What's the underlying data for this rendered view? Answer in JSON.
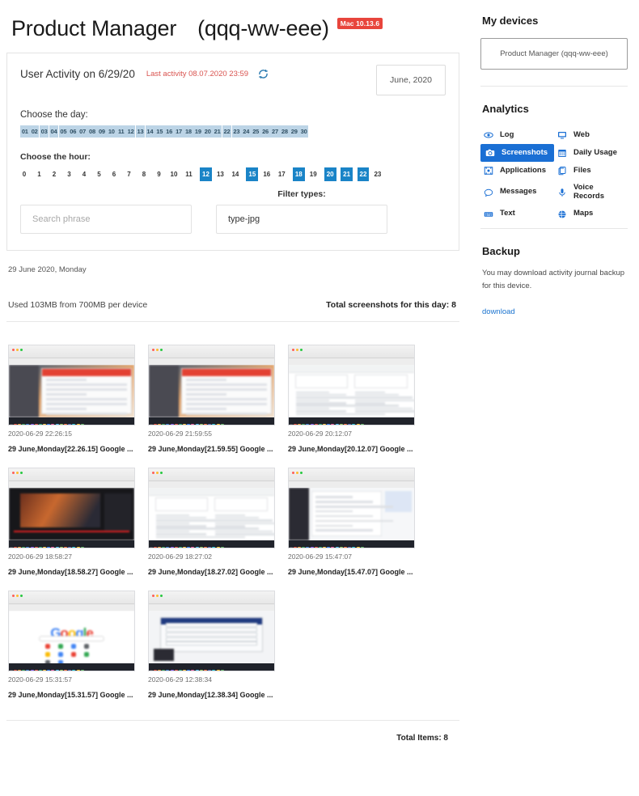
{
  "header": {
    "title": "Product Manager",
    "device": "(qqq-ww-eee)",
    "os_badge": "Mac 10.13.6"
  },
  "activity": {
    "title": "User Activity on 6/29/20",
    "last_activity": "Last activity 08.07.2020 23:59",
    "refresh_icon": "refresh-icon",
    "month_button": "June, 2020",
    "day_label": "Choose the day:",
    "days": [
      "01",
      "02",
      "03",
      "04",
      "05",
      "06",
      "07",
      "08",
      "09",
      "10",
      "11",
      "12",
      "13",
      "14",
      "15",
      "16",
      "17",
      "18",
      "19",
      "20",
      "21",
      "22",
      "23",
      "24",
      "25",
      "26",
      "27",
      "28",
      "29",
      "30"
    ],
    "hour_label": "Choose the hour:",
    "hours": [
      "0",
      "1",
      "2",
      "3",
      "4",
      "5",
      "6",
      "7",
      "8",
      "9",
      "10",
      "11",
      "12",
      "13",
      "14",
      "15",
      "16",
      "17",
      "18",
      "19",
      "20",
      "21",
      "22",
      "23"
    ],
    "hours_selected": [
      "12",
      "15",
      "18",
      "20",
      "21",
      "22"
    ],
    "search_placeholder": "Search phrase",
    "filter_caption": "Filter types:",
    "filter_value": "type-jpg"
  },
  "meta": {
    "date_line": "29 June 2020, Monday",
    "usage": "Used 103MB from 700MB per device",
    "total_day": "Total screenshots for this day: 8"
  },
  "thumbnails": [
    {
      "time": "2020-06-29 22:26:15",
      "title": "29 June,Monday[22.26.15] Google ...",
      "style": "shot-a"
    },
    {
      "time": "2020-06-29 21:59:55",
      "title": "29 June,Monday[21.59.55] Google ...",
      "style": "shot-a"
    },
    {
      "time": "2020-06-29 20:12:07",
      "title": "29 June,Monday[20.12.07] Google ...",
      "style": "shot-doc"
    },
    {
      "time": "2020-06-29 18:58:27",
      "title": "29 June,Monday[18.58.27] Google ...",
      "style": "shot-dark"
    },
    {
      "time": "2020-06-29 18:27:02",
      "title": "29 June,Monday[18.27.02] Google ...",
      "style": "shot-doc"
    },
    {
      "time": "2020-06-29 15:47:07",
      "title": "29 June,Monday[15.47.07] Google ...",
      "style": "shot-blue"
    },
    {
      "time": "2020-06-29 15:31:57",
      "title": "29 June,Monday[15.31.57] Google ...",
      "style": "shot-goog"
    },
    {
      "time": "2020-06-29 12:38:34",
      "title": "29 June,Monday[12.38.34] Google ...",
      "style": "shot-form"
    }
  ],
  "footer": {
    "total_items": "Total Items: 8"
  },
  "sidebar": {
    "devices_heading": "My devices",
    "device_item": "Product Manager (qqq-ww-eee)",
    "analytics_heading": "Analytics",
    "analytics": [
      {
        "label": "Log",
        "icon": "eye-icon",
        "active": false
      },
      {
        "label": "Web",
        "icon": "monitor-icon",
        "active": false
      },
      {
        "label": "Screenshots",
        "icon": "camera-icon",
        "active": true
      },
      {
        "label": "Daily Usage",
        "icon": "calendar-icon",
        "active": false
      },
      {
        "label": "Applications",
        "icon": "app-window-icon",
        "active": false
      },
      {
        "label": "Files",
        "icon": "files-icon",
        "active": false
      },
      {
        "label": "Messages",
        "icon": "chat-bubble-icon",
        "active": false
      },
      {
        "label": "Voice Records",
        "icon": "microphone-icon",
        "active": false
      },
      {
        "label": "Text",
        "icon": "keyboard-icon",
        "active": false
      },
      {
        "label": "Maps",
        "icon": "globe-pin-icon",
        "active": false
      }
    ],
    "backup_heading": "Backup",
    "backup_text": "You may download activity journal backup for this device.",
    "backup_link": "download"
  },
  "colors": {
    "accent": "#1a6fd4",
    "badge": "#e8453c",
    "hour_on": "#1a84c7",
    "day_cell": "#bcd4e6"
  }
}
